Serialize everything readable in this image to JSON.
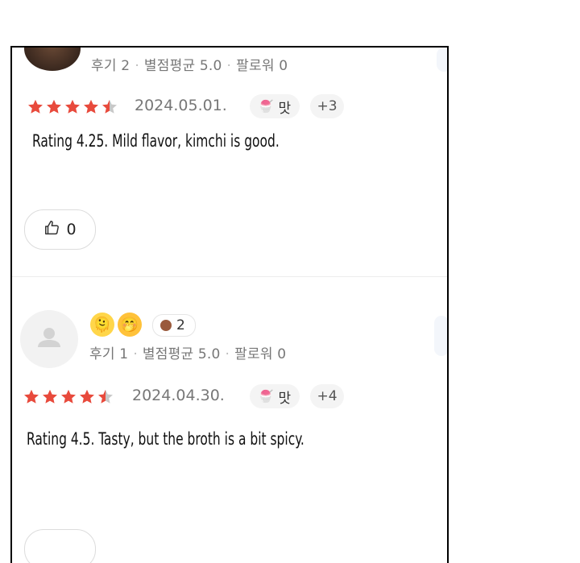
{
  "reviews": [
    {
      "reviews_count": "후기 2",
      "avg_rating": "별점평균 5.0",
      "followers": "팔로워 0",
      "date": "2024.05.01.",
      "tag": "맛",
      "more_tags": "+3",
      "comment": "Rating 4.25. Mild flavor, kimchi is good.",
      "likes": "0",
      "stars_filled_fraction": 0.9
    },
    {
      "reviews_count": "후기 1",
      "avg_rating": "별점평균 5.0",
      "followers": "팔로워 0",
      "badge_count": "2",
      "date": "2024.04.30.",
      "tag": "맛",
      "more_tags": "+4",
      "comment": "Rating 4.5. Tasty, but the broth is a bit spicy.",
      "stars_filled_fraction": 0.9
    }
  ],
  "colors": {
    "star": "#e84a3c",
    "star_empty": "#c8c8c8",
    "meta_text": "#777777"
  },
  "icons": [
    "thumbs-up-icon",
    "user-placeholder-icon",
    "ice-cream-icon",
    "smiley-emoji-icon",
    "hug-emoji-icon",
    "badge-icon"
  ]
}
